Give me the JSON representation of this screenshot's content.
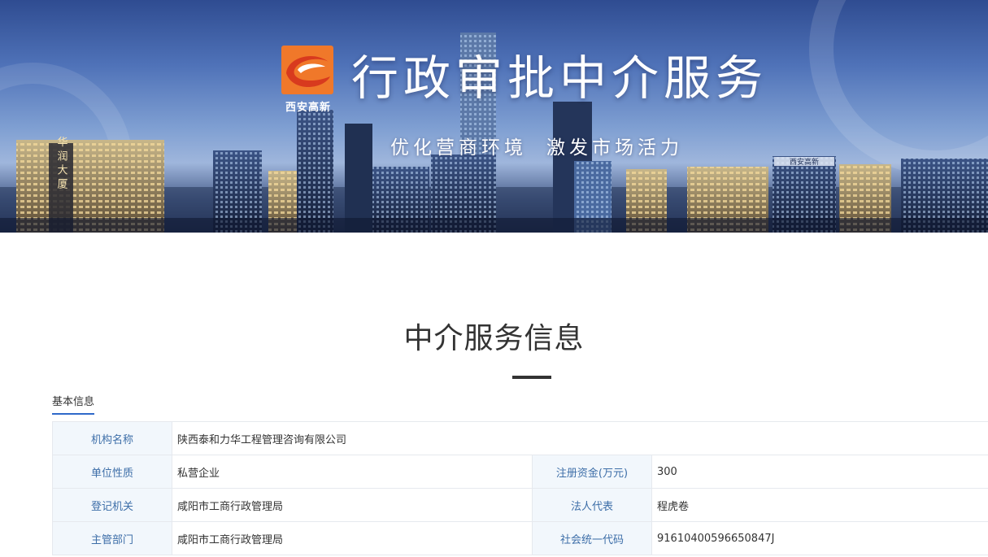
{
  "banner": {
    "logo_text": "西安高新",
    "title": "行政审批中介服务",
    "slogan_1": "优化营商环境",
    "slogan_2": "激发市场活力",
    "building_sign_1": "华 润 大 厦",
    "building_sign_2": "西安高新"
  },
  "section": {
    "title": "中介服务信息",
    "tab": "基本信息"
  },
  "info": {
    "org_name_label": "机构名称",
    "org_name": "陕西泰和力华工程管理咨询有限公司",
    "nature_label": "单位性质",
    "nature": "私营企业",
    "capital_label": "注册资金(万元)",
    "capital": "300",
    "reg_authority_label": "登记机关",
    "reg_authority": "咸阳市工商行政管理局",
    "legal_rep_label": "法人代表",
    "legal_rep": "程虎卷",
    "dept_label": "主管部门",
    "dept": "咸阳市工商行政管理局",
    "credit_code_label": "社会统一代码",
    "credit_code": "91610400596650847J"
  },
  "colors": {
    "label_bg": "#f2f7fc",
    "label_text": "#3d6ea8",
    "accent": "#2f69c9",
    "logo_orange": "#f0782a",
    "logo_red": "#d83a1e"
  }
}
